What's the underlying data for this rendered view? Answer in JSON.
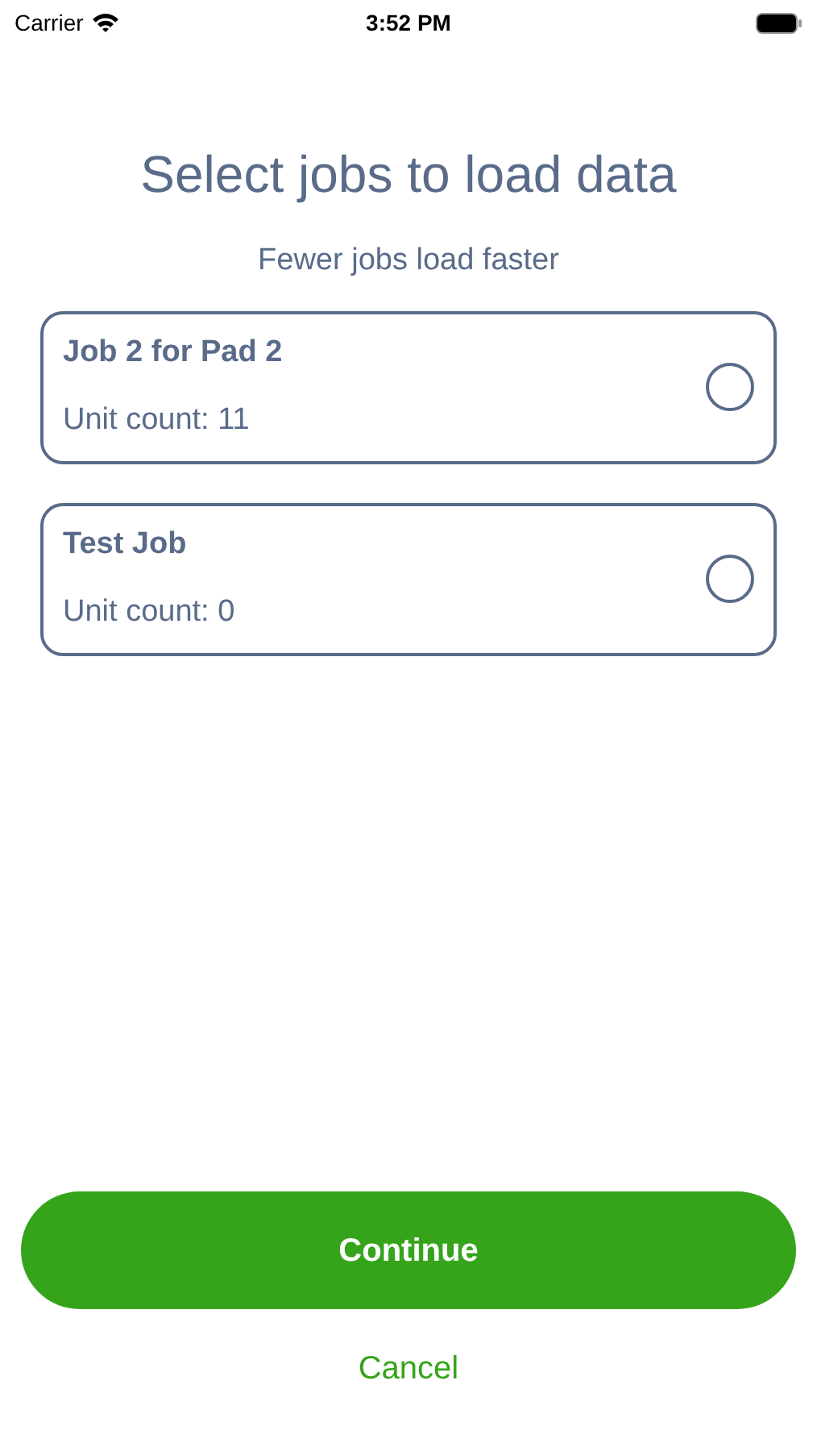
{
  "status_bar": {
    "carrier": "Carrier",
    "time": "3:52 PM"
  },
  "title": "Select jobs to load data",
  "subtitle": "Fewer jobs load faster",
  "jobs": [
    {
      "name": "Job 2 for Pad 2",
      "unit_count": "Unit count: 11",
      "selected": false
    },
    {
      "name": "Test Job",
      "unit_count": "Unit count: 0",
      "selected": false
    }
  ],
  "continue_button": "Continue",
  "cancel_link": "Cancel"
}
